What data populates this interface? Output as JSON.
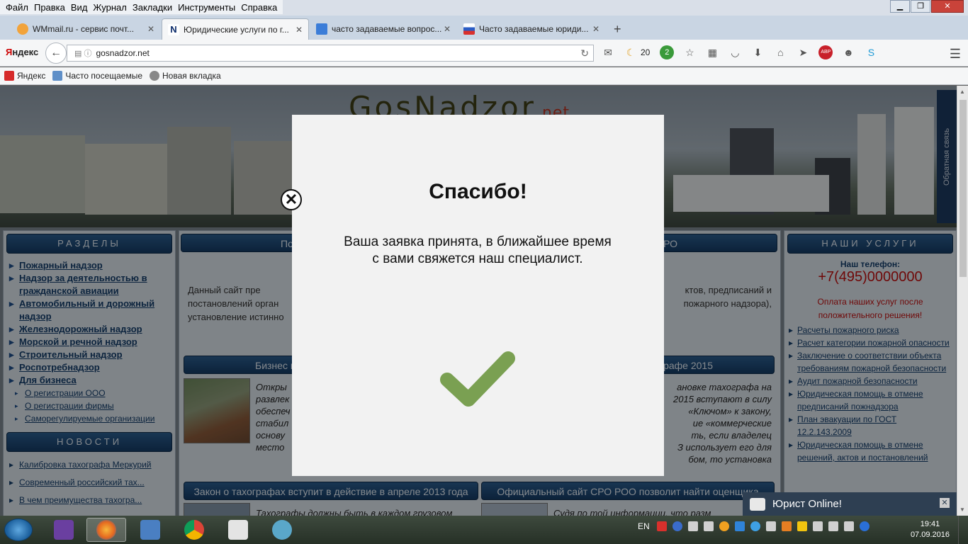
{
  "browser": {
    "menu": [
      "Файл",
      "Правка",
      "Вид",
      "Журнал",
      "Закладки",
      "Инструменты",
      "Справка"
    ],
    "tabs": [
      {
        "title": "WMmail.ru - сервис почт...",
        "color": "#f2a33a"
      },
      {
        "title": "Юридические услуги по г...",
        "color": "#ffffff",
        "letter": "N",
        "active": true
      },
      {
        "title": "часто задаваемые вопрос...",
        "color": "#3b7dd8"
      },
      {
        "title": "Часто задаваемые юриди...",
        "color": "#d9302c"
      }
    ],
    "new_tab": "+",
    "yandex_brand": {
      "red": "Я",
      "rest": "ндекс"
    },
    "url": "gosnadzor.net",
    "toolbar": {
      "moon_count": "20",
      "green_badge": "2",
      "abp": "ABP"
    },
    "bookmarks": [
      "Яндекс",
      "Часто посещаемые",
      "Новая вкладка"
    ]
  },
  "site": {
    "logo": "GosNadzor",
    "logo_suffix": ".net",
    "feedback": "Обратная связь",
    "sections_header": "РАЗДЕЛЫ",
    "sections": [
      "Пожарный надзор",
      "Надзор за деятельностью в гражданской авиации",
      "Автомобильный и дорожный надзор",
      "Железнодорожный надзор",
      "Морской и речной надзор",
      "Строительный надзор",
      "Роспотребнадзор",
      "Для бизнеса"
    ],
    "subsections": [
      "О регистрации ООО",
      "О регистрации фирмы",
      "Саморегулируемые организации"
    ],
    "news_header": "НОВОСТИ",
    "news": [
      "Калибровка тахографа Меркурий",
      "Современный российский тах...",
      "В чем преимущества тахогра..."
    ],
    "mid_header_left": "По",
    "mid_header_right": "РО",
    "intro_left": "Данный сайт пре\nпостановлений орган\nустановление истинно",
    "intro_right": "ктов, предписаний и\nпожарного надзора),",
    "biz_header": "Бизнес п",
    "tacho_header": "графе 2015",
    "article_left": "Откры\nразвлек\nобеспеч\nстабил\nоснову\nместо",
    "article_right": "ановке тахографа на\n2015 вступают в силу\n«Ключом» к закону,\nие «коммерческие\nть, если владелец\nЗ использует его для\nбом, то установка",
    "bottom_header_left": "Закон о тахографах вступит в действие в апреле 2013 года",
    "bottom_header_right": "Официальный сайт СРО РОО позволит найти оценщика",
    "bottom_text_left": "Тахографы должны быть в каждом грузовом",
    "bottom_text_right": "Судя по той информации, что разм",
    "services_header": "НАШИ УСЛУГИ",
    "phone_label": "Наш телефон:",
    "phone": "+7(495)0000000",
    "pay_note": "Оплата наших услуг после положительного решения!",
    "services": [
      "Расчеты пожарного риска",
      "Расчет категории пожарной опасности",
      "Заключение о соответствии объекта требованиям пожарной безопасности",
      "Аудит пожарной безопасности",
      "Юридическая помощь в отмене предписаний пожнадзора",
      "План эвакуации по ГОСТ 12.2.143.2009",
      "Юридическая помощь в отмене решений, актов и постановлений"
    ]
  },
  "modal": {
    "close": "✕",
    "title": "Спасибо!",
    "message": "Ваша заявка принята, в ближайшее время с вами свяжется наш специалист.",
    "check_color": "#7aa052"
  },
  "chat": {
    "label": "Юрист Online!",
    "close": "✕"
  },
  "taskbar": {
    "lang": "EN",
    "time": "19:41",
    "date": "07.09.2016"
  }
}
